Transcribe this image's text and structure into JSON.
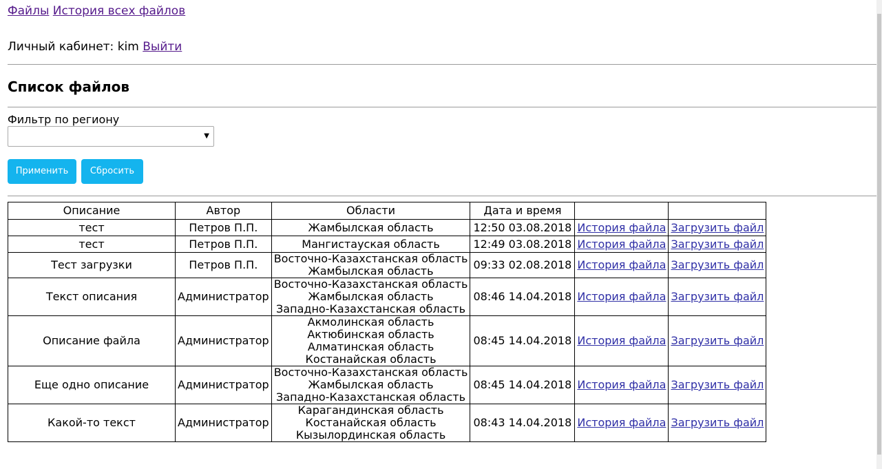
{
  "nav": {
    "files_link": "Файлы",
    "history_link": "История всех файлов"
  },
  "account": {
    "label": "Личный кабинет: kim",
    "logout_link": "Выйти"
  },
  "page_title": "Список файлов",
  "filter": {
    "label": "Фильтр по региону",
    "selected_value": "",
    "apply_label": "Применить",
    "reset_label": "Сбросить"
  },
  "table": {
    "headers": [
      "Описание",
      "Автор",
      "Области",
      "Дата и время",
      "",
      ""
    ],
    "rows": [
      {
        "description": "тест",
        "author": "Петров П.П.",
        "regions": [
          "Жамбылская область"
        ],
        "datetime": "12:50 03.08.2018",
        "history_link": "История файла",
        "upload_link": "Загрузить файл"
      },
      {
        "description": "тест",
        "author": "Петров П.П.",
        "regions": [
          "Мангистауская область"
        ],
        "datetime": "12:49 03.08.2018",
        "history_link": "История файла",
        "upload_link": "Загрузить файл"
      },
      {
        "description": "Тест загрузки",
        "author": "Петров П.П.",
        "regions": [
          "Восточно-Казахстанская область",
          "Жамбылская область"
        ],
        "datetime": "09:33 02.08.2018",
        "history_link": "История файла",
        "upload_link": "Загрузить файл"
      },
      {
        "description": "Текст описания",
        "author": "Администратор",
        "regions": [
          "Восточно-Казахстанская область",
          "Жамбылская область",
          "Западно-Казахстанская область"
        ],
        "datetime": "08:46 14.04.2018",
        "history_link": "История файла",
        "upload_link": "Загрузить файл"
      },
      {
        "description": "Описание файла",
        "author": "Администратор",
        "regions": [
          "Акмолинская область",
          "Актюбинская область",
          "Алматинская область",
          "Костанайская область"
        ],
        "datetime": "08:45 14.04.2018",
        "history_link": "История файла",
        "upload_link": "Загрузить файл"
      },
      {
        "description": "Еще одно описание",
        "author": "Администратор",
        "regions": [
          "Восточно-Казахстанская область",
          "Жамбылская область",
          "Западно-Казахстанская область"
        ],
        "datetime": "08:45 14.04.2018",
        "history_link": "История файла",
        "upload_link": "Загрузить файл"
      },
      {
        "description": "Какой-то текст",
        "author": "Администратор",
        "regions": [
          "Карагандинская область",
          "Костанайская область",
          "Кызылординская область"
        ],
        "datetime": "08:43 14.04.2018",
        "history_link": "История файла",
        "upload_link": "Загрузить файл"
      }
    ]
  },
  "colors": {
    "button_bg": "#14b4ee",
    "button_text": "#ffffff",
    "link_visited": "#551a8b",
    "link": "#2f2fa6",
    "rule": "#9a9a9a"
  }
}
